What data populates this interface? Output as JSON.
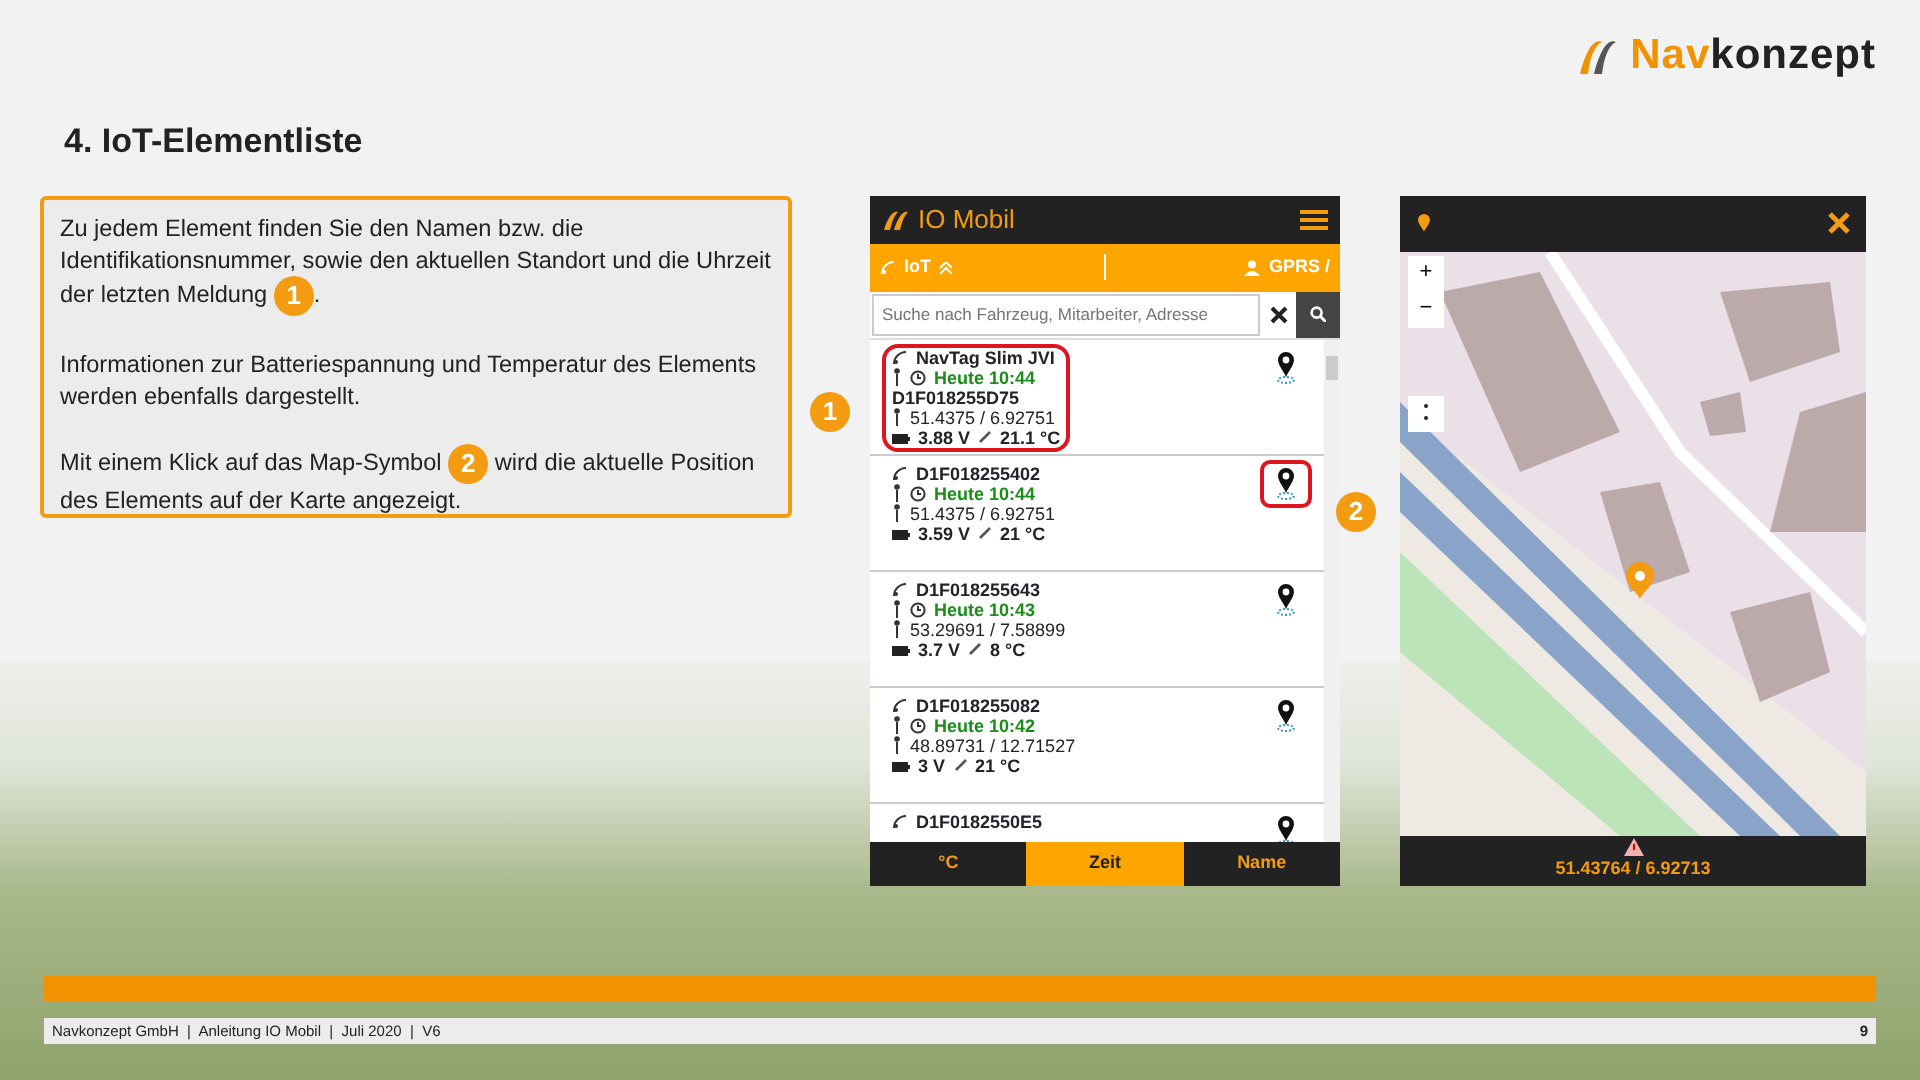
{
  "logo": {
    "prefix": "Nav",
    "suffix": "konzept"
  },
  "title": "4. IoT-Elementliste",
  "callout": {
    "paragraphs": [
      {
        "before": "Zu jedem Element finden Sie den Namen bzw. die Identifikationsnummer, sowie den aktuellen Standort und die Uhrzeit der letzten Meldung",
        "badge": "1",
        "after": "."
      },
      {
        "before": "Informationen zur Batteriespannung und Temperatur des Elements werden ebenfalls dargestellt."
      },
      {
        "before": "Mit einem Klick auf das Map-Symbol",
        "badge": "2",
        "after": "wird die aktuelle Position des Elements auf der Karte angezeigt."
      }
    ]
  },
  "step_badges": [
    "1",
    "2"
  ],
  "app": {
    "title": "IO Mobil",
    "tabs": [
      {
        "label": "IoT"
      },
      {
        "label": "GPRS /"
      }
    ],
    "search": {
      "placeholder": "Suche nach Fahrzeug, Mitarbeiter, Adresse"
    },
    "items": [
      {
        "name": "NavTag Slim JVI",
        "time": "Heute 10:44",
        "id": "D1F018255D75",
        "coords": "51.4375 / 6.92751",
        "battery": "3.88 V",
        "temp": "21.1 °C",
        "highlighted": true,
        "map_highlighted": false
      },
      {
        "name": "D1F018255402",
        "time": "Heute 10:44",
        "coords": "51.4375 / 6.92751",
        "battery": "3.59 V",
        "temp": "21 °C",
        "highlighted": false,
        "map_highlighted": true
      },
      {
        "name": "D1F018255643",
        "time": "Heute 10:43",
        "coords": "53.29691 / 7.58899",
        "battery": "3.7 V",
        "temp": "8 °C",
        "highlighted": false,
        "map_highlighted": false
      },
      {
        "name": "D1F018255082",
        "time": "Heute 10:42",
        "coords": "48.89731 / 12.71527",
        "battery": "3 V",
        "temp": "21 °C",
        "highlighted": false,
        "map_highlighted": false
      },
      {
        "name": "D1F0182550E5",
        "highlighted": false,
        "map_highlighted": false
      }
    ],
    "sort_tabs": [
      {
        "label": "°C",
        "selected": false
      },
      {
        "label": "Zeit",
        "selected": true
      },
      {
        "label": "Name",
        "selected": false
      }
    ]
  },
  "map": {
    "zoom_in": "+",
    "zoom_out": "−",
    "coords": "51.43764 / 6.92713"
  },
  "footer": {
    "text": "Navkonzept GmbH  |  Anleitung IO Mobil  |  Juli 2020  |  V6",
    "page": "9"
  }
}
